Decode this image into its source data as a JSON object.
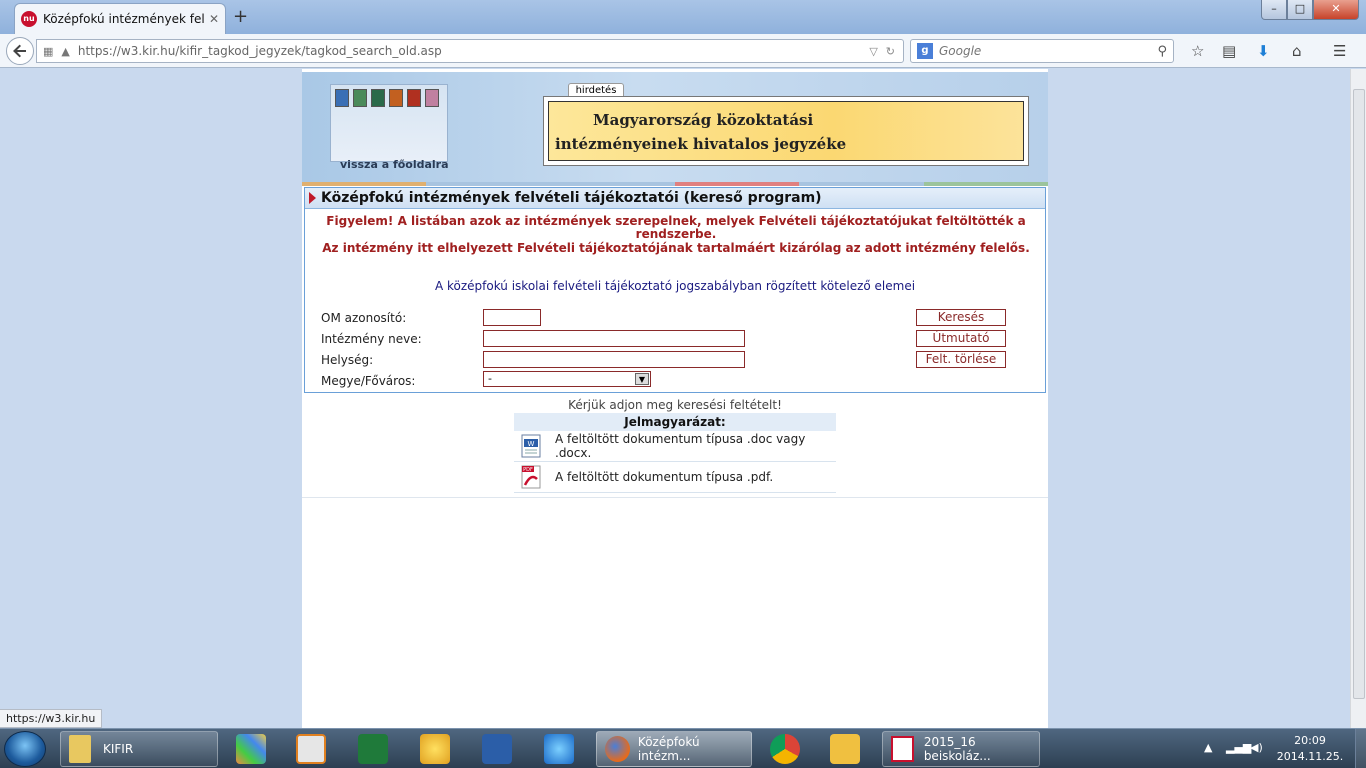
{
  "browser": {
    "tab_title": "Középfokú intézmények fel...",
    "tab_favicon_text": "nu",
    "tab_close": "✕",
    "new_tab": "+",
    "window_controls": {
      "minimize": "–",
      "maximize": "□",
      "close": "✕"
    },
    "url": "https://w3.kir.hu/kifir_tagkod_jegyzek/tagkod_search_old.asp",
    "search_placeholder": "Google",
    "status_url": "https://w3.kir.hu"
  },
  "banner": {
    "back_link": "vissza a főoldalra",
    "ad_label": "hirdetés",
    "ad_line1": "Magyarország közoktatási",
    "ad_line2": "intézményeinek hivatalos jegyzéke"
  },
  "form": {
    "heading": "Középfokú intézmények felvételi tájékoztatói (kereső program)",
    "warning1": "Figyelem! A listában azok az intézmények szerepelnek, melyek Felvételi tájékoztatójukat feltöltötték a rendszerbe.",
    "warning2": "Az intézmény itt elhelyezett Felvételi tájékoztatójának tartalmáért kizárólag az adott intézmény felelős.",
    "law_link": "A középfokú iskolai felvételi tájékoztató jogszabályban rögzített kötelező elemei",
    "fields": {
      "om_label": "OM azonosító:",
      "om_value": "",
      "name_label": "Intézmény neve:",
      "name_value": "",
      "city_label": "Helység:",
      "city_value": "",
      "county_label": "Megye/Főváros:",
      "county_value": "-"
    },
    "buttons": {
      "search": "Keresés",
      "guide": "Útmutató",
      "clear": "Felt. törlése"
    }
  },
  "results": {
    "prompt": "Kérjük adjon meg keresési feltételt!",
    "legend_title": "Jelmagyarázat:",
    "legend_doc": "A feltöltött dokumentum típusa .doc vagy .docx.",
    "legend_pdf": "A feltöltött dokumentum típusa .pdf."
  },
  "taskbar": {
    "items": [
      {
        "label": "KIFIR"
      },
      {
        "label": "Középfokú intézm..."
      },
      {
        "label": "2015_16 beiskoláz..."
      }
    ],
    "clock_time": "20:09",
    "clock_date": "2014.11.25."
  },
  "colors": {
    "accent_red": "#a02020",
    "link_blue": "#1a1a80",
    "border_blue": "#6aa0d8"
  }
}
